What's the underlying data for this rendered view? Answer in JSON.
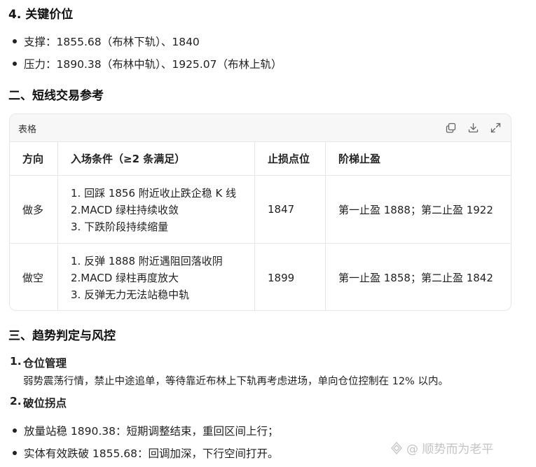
{
  "section4": {
    "title": "4. 关键价位",
    "items": [
      "支撑：1855.68（布林下轨）、1840",
      "压力：1890.38（布林中轨）、1925.07（布林上轨）"
    ]
  },
  "section2": {
    "title": "二、短线交易参考"
  },
  "table": {
    "title": "表格",
    "headers": [
      "方向",
      "入场条件（≥2 条满足）",
      "止损点位",
      "阶梯止盈"
    ],
    "rows": [
      {
        "direction": "做多",
        "conditions": [
          "1. 回踩 1856 附近收止跌企稳 K 线",
          "2.MACD 绿柱持续收敛",
          "3. 下跌阶段持续缩量"
        ],
        "stop": "1847",
        "target": "第一止盈 1888；第二止盈 1922"
      },
      {
        "direction": "做空",
        "conditions": [
          "1. 反弹 1888 附近遇阻回落收阴",
          "2.MACD 绿柱再度放大",
          "3. 反弹无力无法站稳中轨"
        ],
        "stop": "1899",
        "target": "第一止盈 1858；第二止盈 1842"
      }
    ]
  },
  "section3": {
    "title": "三、趋势判定与风控",
    "ordered": [
      {
        "num": "1.",
        "title": "仓位管理",
        "body": "弱势震荡行情，禁止中途追单，等待靠近布林上下轨再考虑进场，单向仓位控制在 12% 以内。"
      },
      {
        "num": "2.",
        "title": "破位拐点"
      }
    ],
    "items": [
      "放量站稳 1890.38：短期调整结束，重回区间上行；",
      "实体有效跌破 1855.68：回调加深，下行空间打开。"
    ]
  },
  "watermark": "@ 顺势而为老平"
}
